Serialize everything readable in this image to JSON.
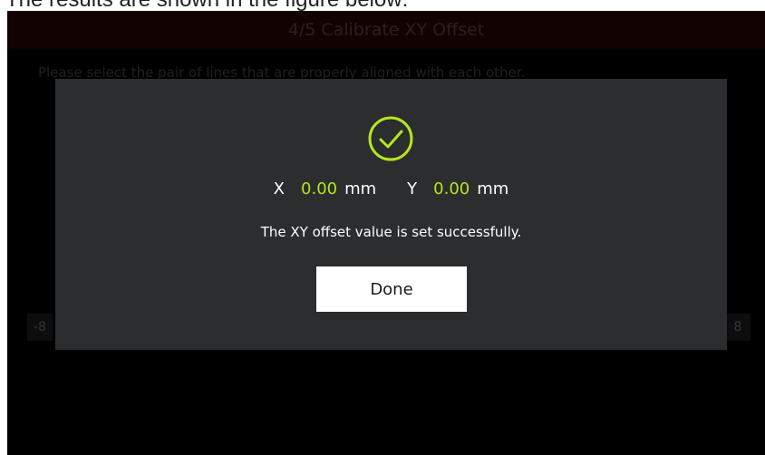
{
  "caption": "The results are shown in the figure below:",
  "screen": {
    "title": "4/5 Calibrate XY Offset",
    "instruction": "Please select the pair of lines that are properly aligned with each other.",
    "scale_left": "-8",
    "scale_right": "8"
  },
  "dialog": {
    "icon": "check-circle-icon",
    "x_label": "X",
    "x_value": "0.00",
    "x_unit": "mm",
    "y_label": "Y",
    "y_value": "0.00",
    "y_unit": "mm",
    "message": "The XY offset value is set successfully.",
    "done_label": "Done"
  },
  "colors": {
    "accent": "#b5e61d",
    "dialog_bg": "#2b2d2f",
    "title_bar": "#1a0303"
  }
}
